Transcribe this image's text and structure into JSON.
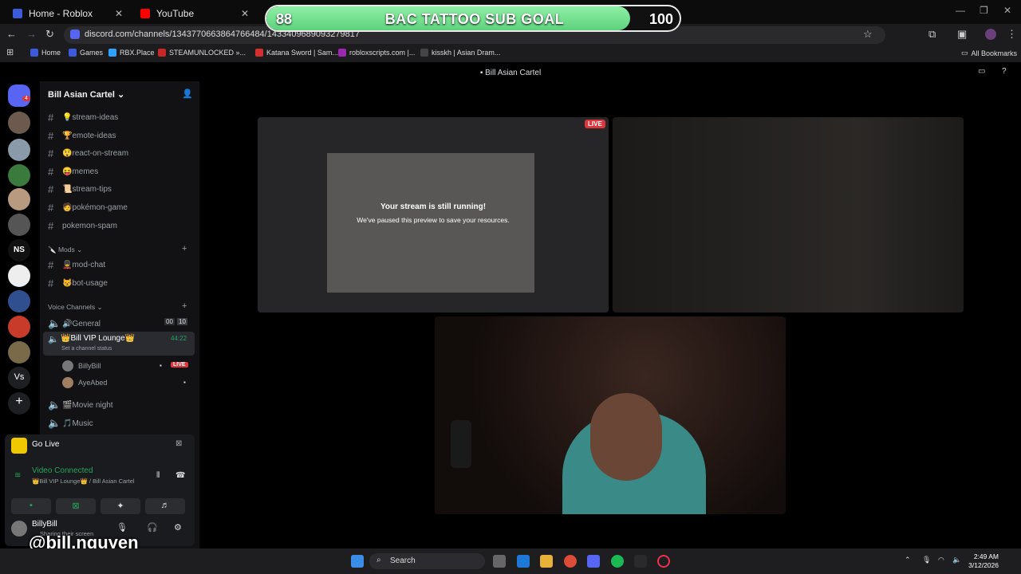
{
  "browser": {
    "tabs": [
      {
        "label": "Home - Roblox",
        "color": "#3b5bdb"
      },
      {
        "label": "YouTube",
        "color": "#ff0000"
      }
    ],
    "url": "discord.com/channels/1343770663864766484/1433409689093279817",
    "bookmarks": [
      "Home",
      "Games",
      "RBX.Place",
      "STEAMUNLOCKED »...",
      "Katana Sword | Sam...",
      "robloxscripts.com |...",
      "kisskh | Asian Dram..."
    ],
    "all_bookmarks": "All Bookmarks"
  },
  "overlay": {
    "goal_label": "BAC TATTOO SUB GOAL",
    "current": "88",
    "target": "100",
    "progress": 0.88,
    "handle": "@bill.nguyen"
  },
  "discord": {
    "window_title": "Bill Asian Cartel",
    "server_name": "Bill Asian Cartel",
    "guild_badge": "4",
    "text_channels": [
      "💡stream-ideas",
      "🏆emote-ideas",
      "😲react-on-stream",
      "😝memes",
      "📜stream-tips",
      "🧑pokémon-game",
      "pokemon-spam"
    ],
    "mods_category": "Mods",
    "mod_channels": [
      "💂mod-chat",
      "😾bot-usage"
    ],
    "voice_category": "Voice Channels",
    "voice_general": "🔊General",
    "voice_general_counts": [
      "00",
      "10"
    ],
    "vip_lounge": "👑Bill VIP Lounge👑",
    "vip_timer": "44:22",
    "vip_status": "Set a channel status",
    "users": [
      {
        "name": "BillyBill",
        "live": "LIVE"
      },
      {
        "name": "AyeAbed"
      }
    ],
    "movie_night": "🎬Movie night",
    "music": "🎵Music",
    "go_live": "Go Live",
    "video_connected": "Video Connected",
    "connected_to": "👑Bill VIP Lounge👑 / Bill Asian Cartel",
    "me_name": "BillyBill",
    "me_status": "Sharing their screen"
  },
  "stage": {
    "live_badge": "LIVE",
    "paused_title": "Your stream is still running!",
    "paused_subtitle": "We've paused this preview to save your resources."
  },
  "taskbar": {
    "search": "Search",
    "time": "2:49 AM",
    "date": "3/12/2026"
  }
}
